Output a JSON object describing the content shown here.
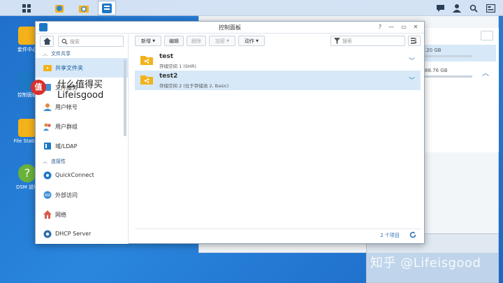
{
  "window": {
    "title": "控制面板"
  },
  "sidebar": {
    "search_placeholder": "搜索",
    "sections": {
      "file_sharing": "文件共享",
      "connectivity": "连接性"
    },
    "items": [
      "共享文件夹",
      "文件服务",
      "用户帐号",
      "用户群组",
      "域/LDAP",
      "QuickConnect",
      "外部访问",
      "网络",
      "DHCP Server"
    ]
  },
  "toolbar": {
    "create": "新增",
    "edit": "编辑",
    "delete": "删除",
    "encrypt": "加密",
    "action": "动作",
    "filter_placeholder": "搜索"
  },
  "folders": [
    {
      "name": "test",
      "desc": "存储空间 1 (SHR)"
    },
    {
      "name": "test2",
      "desc": "存储空间 2 (位于存储池 2, Basic)"
    }
  ],
  "footer": {
    "count": "2 个项目"
  },
  "desktop": {
    "icons": [
      "套件中心",
      "控制面板",
      "File Station",
      "DSM 说明"
    ]
  },
  "background": {
    "size1": ".20 GB",
    "size2": "88.76 GB"
  },
  "overlay": {
    "logo_char": "值",
    "line1": "什么值得买",
    "line2": "Lifeisgood"
  },
  "watermark": "知乎 @Lifeisgood",
  "colors": {
    "accent": "#1d78c6",
    "selected": "#d7e9f8",
    "folder": "#f2b21b"
  }
}
